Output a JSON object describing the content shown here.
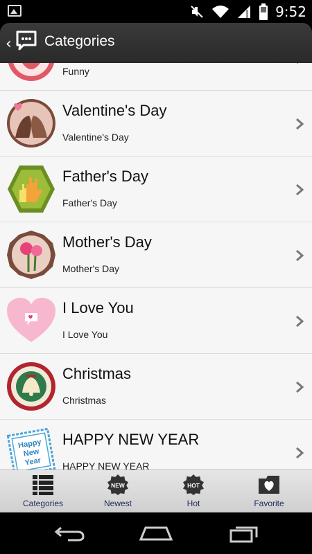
{
  "status_bar": {
    "time": "9:52",
    "icons": [
      "image-icon",
      "mute-icon",
      "wifi-icon",
      "signal-icon",
      "battery-icon"
    ]
  },
  "action_bar": {
    "title": "Categories",
    "icon": "chat-bubble-icon"
  },
  "categories": [
    {
      "title": "",
      "subtitle": "Funny",
      "icon": "funny-icon"
    },
    {
      "title": "Valentine's Day",
      "subtitle": "Valentine's Day",
      "icon": "valentine-icon"
    },
    {
      "title": "Father's Day",
      "subtitle": "Father's Day",
      "icon": "fathers-day-icon"
    },
    {
      "title": "Mother's Day",
      "subtitle": "Mother's Day",
      "icon": "mothers-day-icon"
    },
    {
      "title": "I Love You",
      "subtitle": "I Love You",
      "icon": "heart-icon"
    },
    {
      "title": "Christmas",
      "subtitle": "Christmas",
      "icon": "christmas-bell-icon"
    },
    {
      "title": "HAPPY NEW YEAR",
      "subtitle": "HAPPY NEW YEAR",
      "icon": "new-year-stamp-icon"
    }
  ],
  "tabs": [
    {
      "label": "Categories",
      "icon": "list-icon"
    },
    {
      "label": "Newest",
      "icon": "new-badge-icon",
      "badge": "NEW"
    },
    {
      "label": "Hot",
      "icon": "hot-badge-icon",
      "badge": "HOT"
    },
    {
      "label": "Favorite",
      "icon": "favorite-folder-icon"
    }
  ],
  "thumb_text": {
    "new_year_lines": [
      "Happy",
      "New",
      "Year"
    ]
  },
  "colors": {
    "action_bar": "#2e2e2e",
    "list_bg": "#f6f6f6",
    "tab_label": "#1c2a5a",
    "chevron": "#777777"
  }
}
